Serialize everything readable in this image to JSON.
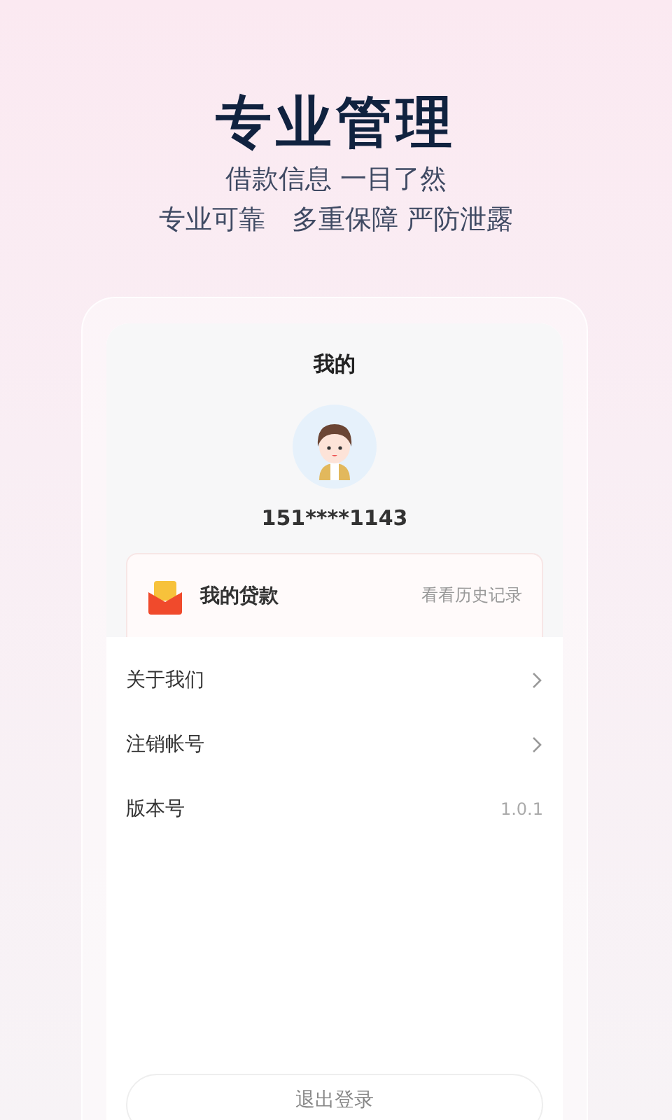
{
  "headline": "专业管理",
  "subtitles": [
    "借款信息 一目了然",
    "专业可靠　多重保障 严防泄露"
  ],
  "screen": {
    "title": "我的",
    "phone": "151****1143",
    "loan_card": {
      "label": "我的贷款",
      "link": "看看历史记录"
    },
    "menu": [
      {
        "kind": "link",
        "label": "关于我们"
      },
      {
        "kind": "link",
        "label": "注销帐号"
      },
      {
        "kind": "value",
        "label": "版本号",
        "value": "1.0.1"
      }
    ],
    "logout": "退出登录"
  }
}
